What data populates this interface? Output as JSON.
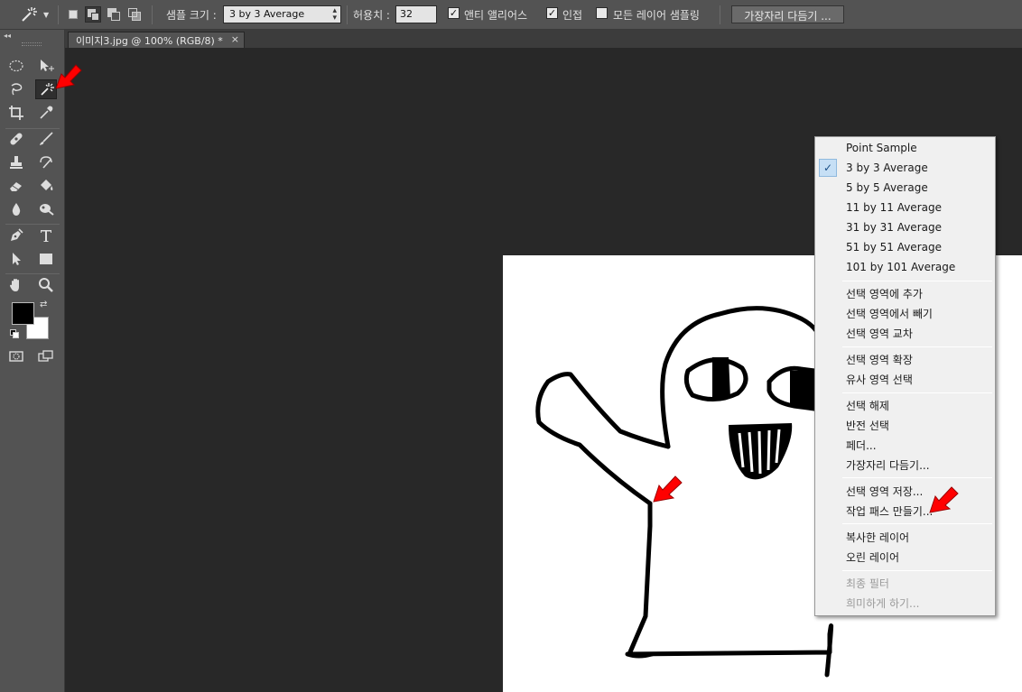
{
  "options_bar": {
    "sample_size_label": "샘플 크기 :",
    "sample_size_value": "3 by 3 Average",
    "tolerance_label": "허용치 :",
    "tolerance_value": "32",
    "anti_alias_label": "앤티 앨리어스",
    "contiguous_label": "인접",
    "sample_all_layers_label": "모든 레이어 샘플링",
    "refine_edge_button": "가장자리 다듬기 ...",
    "anti_alias_checked": true,
    "contiguous_checked": true,
    "sample_all_layers_checked": false
  },
  "document": {
    "tab_title": "이미지3.jpg @ 100% (RGB/8) *",
    "close_glyph": "×"
  },
  "toolbar": {
    "collapse_glyph": "◂◂",
    "active_tool": "magic-wand",
    "foreground_color": "#000000",
    "background_color": "#ffffff"
  },
  "context_menu": {
    "groups": [
      [
        "Point Sample",
        "3 by 3 Average",
        "5 by 5 Average",
        "11 by 11 Average",
        "31 by 31 Average",
        "51 by 51 Average",
        "101 by 101 Average"
      ],
      [
        "선택 영역에 추가",
        "선택 영역에서 빼기",
        "선택 영역 교차"
      ],
      [
        "선택 영역 확장",
        "유사 영역 선택"
      ],
      [
        "선택 해제",
        "반전 선택",
        "페더...",
        "가장자리 다듬기..."
      ],
      [
        "선택 영역 저장...",
        "작업 패스 만들기..."
      ],
      [
        "복사한 레이어",
        "오린 레이어"
      ],
      [
        "최종 필터",
        "희미하게 하기..."
      ]
    ],
    "checked_item": "3 by 3 Average",
    "check_glyph": "✓",
    "disabled_items": [
      "최종 필터",
      "희미하게 하기..."
    ]
  },
  "annotations": {
    "arrow_color": "#ff0000"
  }
}
